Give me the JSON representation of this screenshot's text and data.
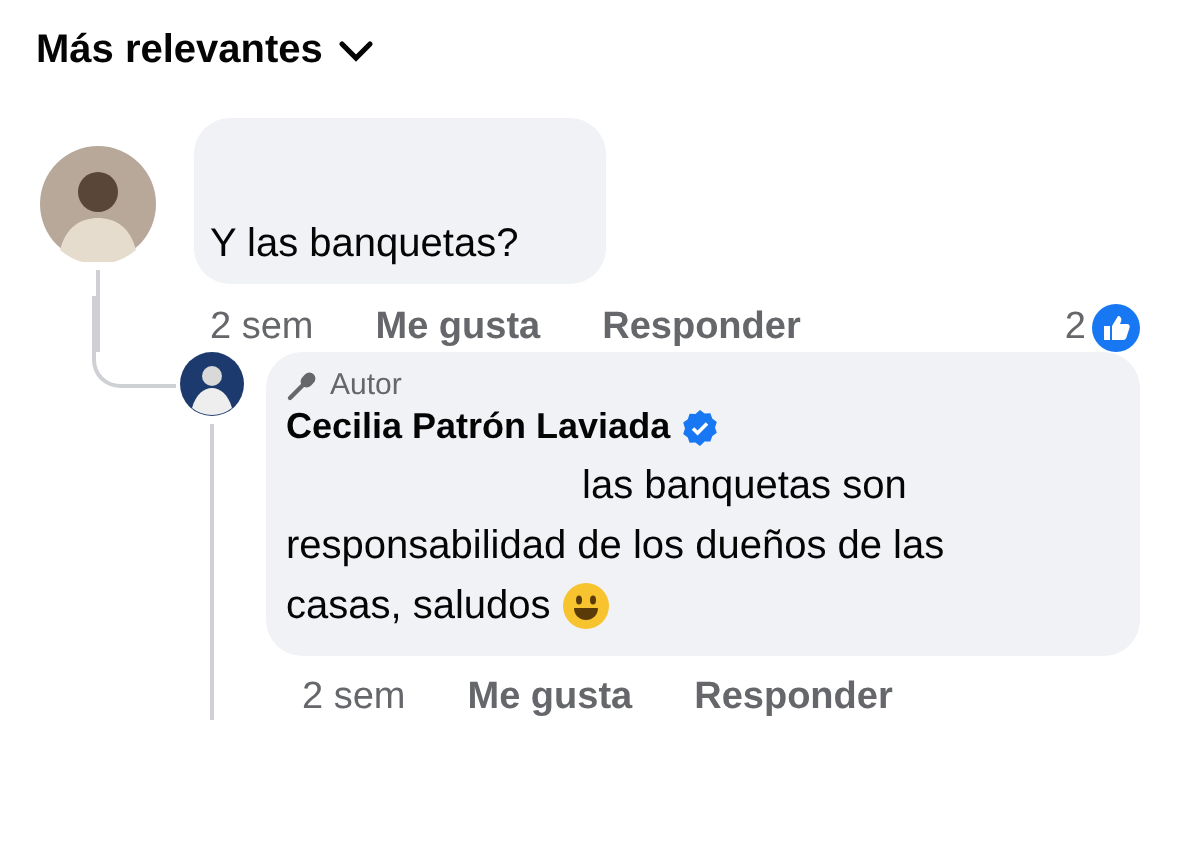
{
  "header": {
    "label": "Más relevantes"
  },
  "comments": [
    {
      "text": "Y las banquetas?",
      "time": "2 sem",
      "like": "Me gusta",
      "reply": "Responder",
      "reactions": "2",
      "replies": [
        {
          "badge": "Autor",
          "author": "Cecilia Patrón Laviada",
          "verified": true,
          "text_lines": [
            "las banquetas son",
            "responsabilidad de los dueños de las",
            "casas, saludos"
          ],
          "time": "2 sem",
          "like": "Me gusta",
          "reply": "Responder"
        }
      ]
    }
  ]
}
